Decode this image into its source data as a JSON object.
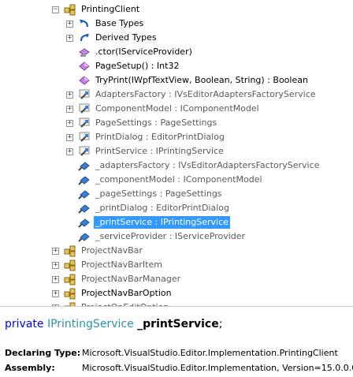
{
  "tree": {
    "rows": [
      {
        "label": "PrintingClient",
        "expander": "−",
        "icon": "class-icon",
        "gray": false
      },
      {
        "label": "Base Types",
        "expander": "+",
        "icon": "base-types-icon",
        "gray": false
      },
      {
        "label": "Derived Types",
        "expander": "+",
        "icon": "derived-types-icon",
        "gray": false
      },
      {
        "label": ".ctor(IServiceProvider)",
        "expander": "",
        "icon": "constructor-icon",
        "gray": false
      },
      {
        "label": "PageSetup() : Int32",
        "expander": "",
        "icon": "method-icon",
        "gray": false
      },
      {
        "label": "TryPrint(IWpfTextView, Boolean, String) : Boolean",
        "expander": "",
        "icon": "method-icon",
        "gray": false
      },
      {
        "label": "AdaptersFactory : IVsEditorAdaptersFactoryService",
        "expander": "+",
        "icon": "property-icon",
        "gray": true
      },
      {
        "label": "ComponentModel : IComponentModel",
        "expander": "+",
        "icon": "property-icon",
        "gray": true
      },
      {
        "label": "PageSettings : PageSettings",
        "expander": "+",
        "icon": "property-icon",
        "gray": true
      },
      {
        "label": "PrintDialog : EditorPrintDialog",
        "expander": "+",
        "icon": "property-icon",
        "gray": true
      },
      {
        "label": "PrintService : IPrintingService",
        "expander": "+",
        "icon": "property-icon",
        "gray": true
      },
      {
        "label": "_adaptersFactory : IVsEditorAdaptersFactoryService",
        "expander": "",
        "icon": "field-icon",
        "gray": true
      },
      {
        "label": "_componentModel : IComponentModel",
        "expander": "",
        "icon": "field-icon",
        "gray": true
      },
      {
        "label": "_pageSettings : PageSettings",
        "expander": "",
        "icon": "field-icon",
        "gray": true
      },
      {
        "label": "_printDialog : EditorPrintDialog",
        "expander": "",
        "icon": "field-icon",
        "gray": true
      },
      {
        "label": "_printService : IPrintingService",
        "expander": "",
        "icon": "field-icon",
        "gray": false,
        "selected": true
      },
      {
        "label": "_serviceProvider : IServiceProvider",
        "expander": "",
        "icon": "field-icon",
        "gray": true
      },
      {
        "label": "ProjectNavBar",
        "expander": "+",
        "icon": "class-icon",
        "gray": true
      },
      {
        "label": "ProjectNavBarItem",
        "expander": "+",
        "icon": "class-icon",
        "gray": true
      },
      {
        "label": "ProjectNavBarManager",
        "expander": "+",
        "icon": "class-icon",
        "gray": true
      },
      {
        "label": "ProjectNavBarOption",
        "expander": "+",
        "icon": "class-icon",
        "gray": false
      },
      {
        "label": "ProjectOnEditOption",
        "expander": "+",
        "icon": "class-icon",
        "gray": true
      }
    ]
  },
  "details": {
    "signature": {
      "modifier": "private",
      "type": "IPrintingService",
      "name": "_printService",
      "terminator": ";"
    },
    "declaring_type_label": "Declaring Type:",
    "declaring_type_value": "Microsoft.VisualStudio.Editor.Implementation.PrintingClient",
    "assembly_label": "Assembly:",
    "assembly_value": "Microsoft.VisualStudio.Editor.Implementation, Version=15.0.0.0"
  },
  "colors": {
    "selection": "#3399ff",
    "keyword": "#0000ff",
    "type": "#2b91af",
    "gray_text": "#5a5a5a"
  }
}
